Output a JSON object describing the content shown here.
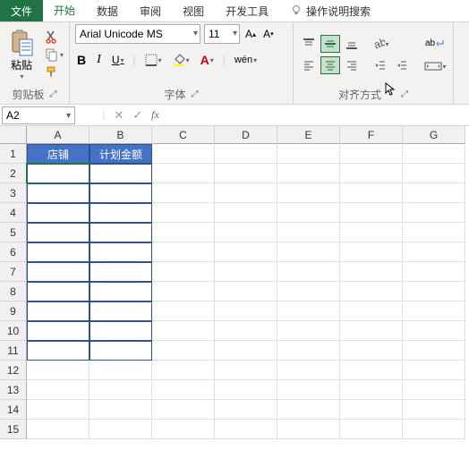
{
  "tabs": {
    "file": "文件",
    "home": "开始",
    "data": "数据",
    "review": "审阅",
    "view": "视图",
    "dev": "开发工具",
    "help": "操作说明搜索"
  },
  "ribbon": {
    "clipboard": {
      "paste": "粘贴",
      "label": "剪贴板"
    },
    "font": {
      "name": "Arial Unicode MS",
      "size": "11",
      "bold": "B",
      "italic": "I",
      "underline": "U",
      "label": "字体",
      "grow": "A",
      "shrink": "A",
      "wen": "wén"
    },
    "align": {
      "label": "对齐方式",
      "wrap": "ab"
    }
  },
  "namebox": "A2",
  "fx": "fx",
  "columns": [
    "A",
    "B",
    "C",
    "D",
    "E",
    "F",
    "G"
  ],
  "rows": [
    "1",
    "2",
    "3",
    "4",
    "5",
    "6",
    "7",
    "8",
    "9",
    "10",
    "11",
    "12",
    "13",
    "14",
    "15"
  ],
  "headers": {
    "A1": "店铺",
    "B1": "计划金额"
  },
  "colors": {
    "accent": "#217346",
    "tableHeader": "#4472c4"
  }
}
